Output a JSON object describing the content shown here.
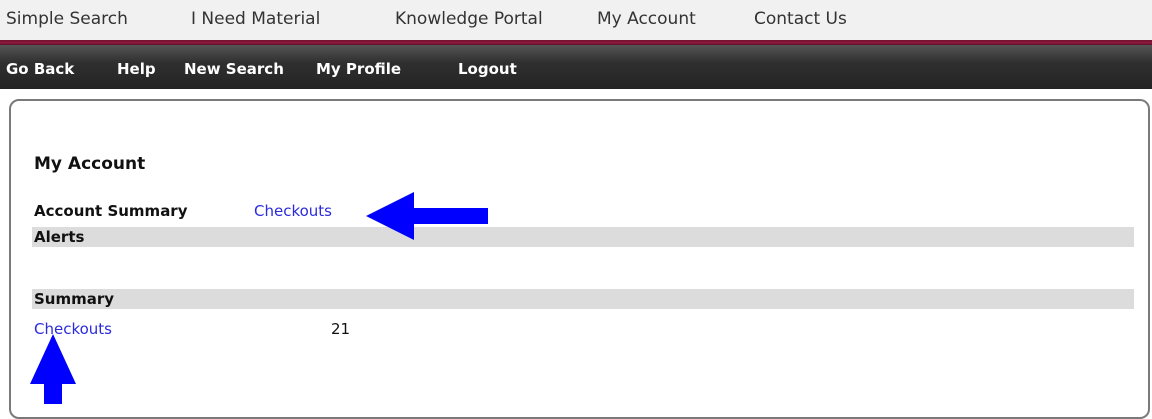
{
  "top_nav": {
    "items": [
      "Simple Search",
      "I Need Material",
      "Knowledge Portal",
      "My Account",
      "Contact Us"
    ]
  },
  "sub_nav": {
    "items": [
      "Go Back",
      "Help",
      "New Search",
      "My Profile",
      "Logout"
    ]
  },
  "main": {
    "title": "My Account",
    "account_summary_label": "Account Summary",
    "checkouts_link": "Checkouts",
    "alerts_header": "Alerts",
    "summary_header": "Summary",
    "summary_rows": [
      {
        "label": "Checkouts",
        "count": "21"
      }
    ]
  },
  "colors": {
    "link": "#2b2bdc",
    "annotation_arrow": "#0000ff",
    "nav_rule": "#8c1a3c",
    "sub_nav_bg": "#2f2f2f"
  }
}
